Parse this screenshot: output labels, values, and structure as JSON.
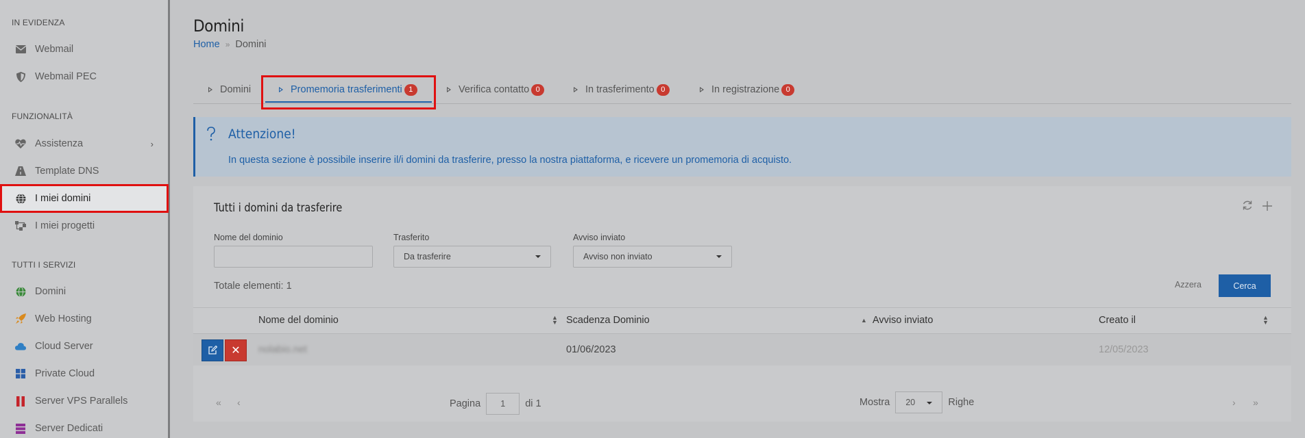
{
  "sidebar": {
    "sections": [
      "IN EVIDENZA",
      "FUNZIONALITÀ",
      "TUTTI I SERVIZI"
    ],
    "items": [
      {
        "label": "Webmail",
        "icon": "envelope-icon"
      },
      {
        "label": "Webmail PEC",
        "icon": "shield-icon"
      },
      {
        "label": "Assistenza",
        "icon": "heartbeat-icon"
      },
      {
        "label": "Template DNS",
        "icon": "road-icon"
      },
      {
        "label": "I miei domini",
        "icon": "globe-icon"
      },
      {
        "label": "I miei progetti",
        "icon": "sitemap-icon"
      },
      {
        "label": "Domini",
        "icon": "globe-icon"
      },
      {
        "label": "Web Hosting",
        "icon": "rocket-icon"
      },
      {
        "label": "Cloud Server",
        "icon": "cloud-icon"
      },
      {
        "label": "Private Cloud",
        "icon": "windows-icon"
      },
      {
        "label": "Server VPS Parallels",
        "icon": "parallels-icon"
      },
      {
        "label": "Server Dedicati",
        "icon": "server-icon"
      }
    ]
  },
  "header": {
    "title": "Domini",
    "breadcrumb": {
      "home": "Home",
      "sep": "»",
      "current": "Domini"
    }
  },
  "tabs": [
    {
      "label": "Domini",
      "badge": ""
    },
    {
      "label": "Promemoria trasferimenti",
      "badge": "1"
    },
    {
      "label": "Verifica contatto",
      "badge": "0"
    },
    {
      "label": "In trasferimento",
      "badge": "0"
    },
    {
      "label": "In registrazione",
      "badge": "0"
    }
  ],
  "alert": {
    "title": "Attenzione!",
    "message": "In questa sezione è possibile inserire il/i domini da trasferire, presso la nostra piattaforma, e ricevere un promemoria di acquisto."
  },
  "card": {
    "title": "Tutti i domini da trasferire",
    "filters": {
      "domain_label": "Nome del dominio",
      "domain_value": "",
      "transferred_label": "Trasferito",
      "transferred_value": "Da trasferire",
      "notice_label": "Avviso inviato",
      "notice_value": "Avviso non inviato"
    },
    "total": "Totale elementi: 1",
    "reset_label": "Azzera",
    "search_label": "Cerca"
  },
  "table": {
    "columns": [
      "Nome del dominio",
      "Scadenza Dominio",
      "Avviso inviato",
      "Creato il"
    ],
    "rows": [
      {
        "domain": "nolabio.net",
        "expiry": "01/06/2023",
        "notice": "",
        "created": "12/05/2023"
      }
    ]
  },
  "pagination": {
    "page_label": "Pagina",
    "page": "1",
    "of_label": "di 1",
    "show_label": "Mostra",
    "rows_value": "20",
    "rows_label": "Righe",
    "first": "«",
    "prev": "‹",
    "next": "›",
    "last": "»"
  },
  "colors": {
    "accent": "#1e5fa6",
    "danger": "#c83a30",
    "highlight": "#e01010"
  }
}
